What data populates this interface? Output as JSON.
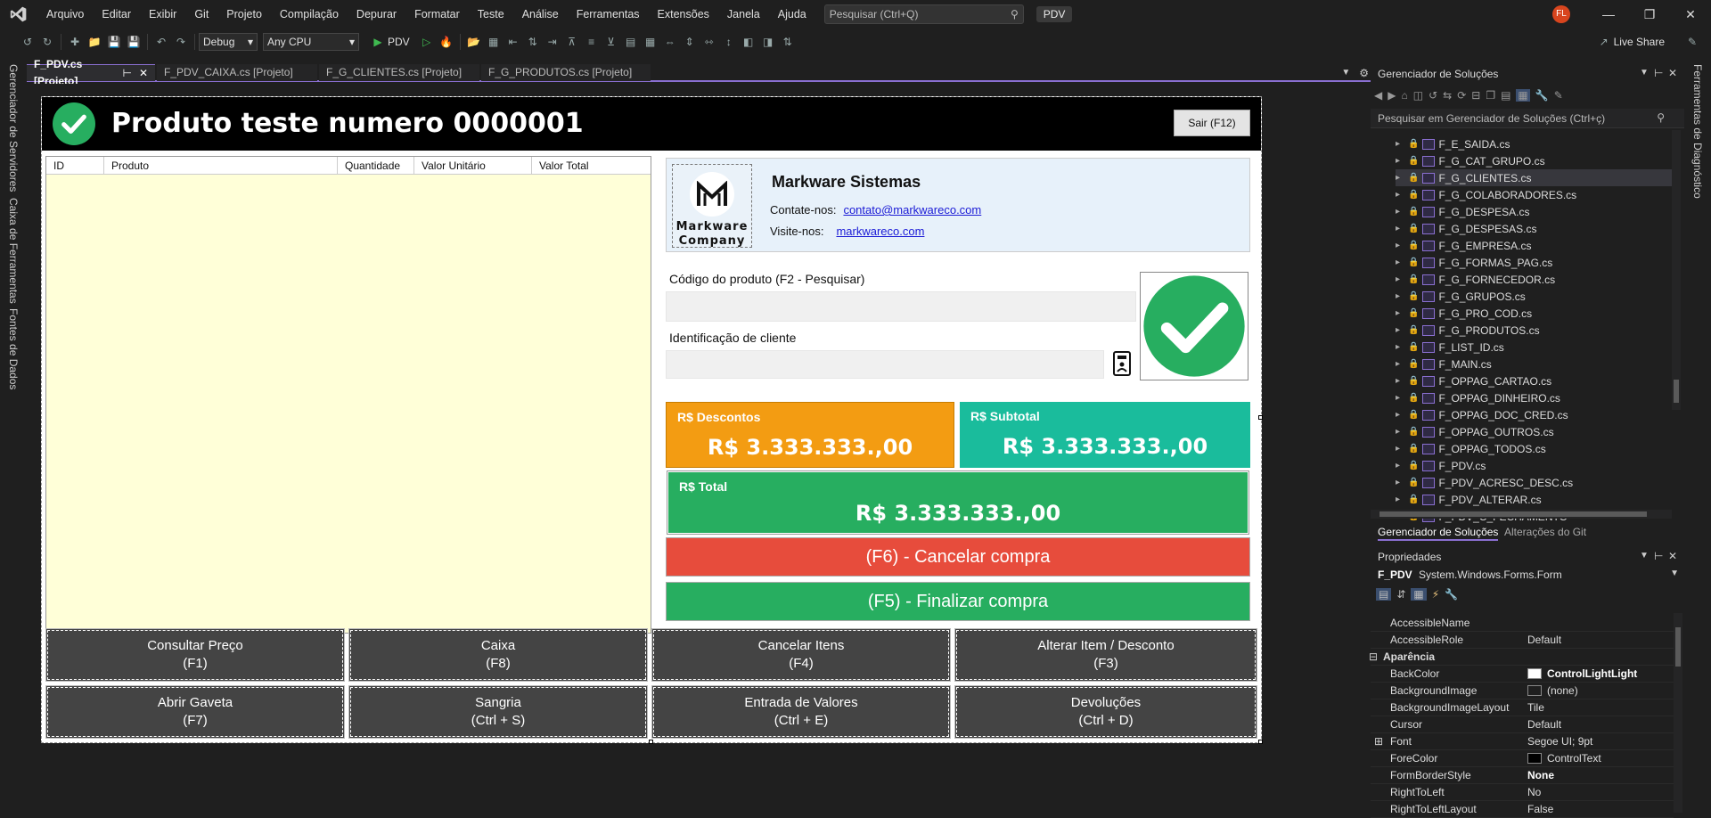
{
  "menubar": {
    "items": [
      "Arquivo",
      "Editar",
      "Exibir",
      "Git",
      "Projeto",
      "Compilação",
      "Depurar",
      "Formatar",
      "Teste",
      "Análise",
      "Ferramentas",
      "Extensões",
      "Janela",
      "Ajuda"
    ],
    "search_placeholder": "Pesquisar (Ctrl+Q)",
    "solution_badge": "PDV",
    "avatar_initials": "FL"
  },
  "toolbar": {
    "config": "Debug",
    "platform": "Any CPU",
    "run_target": "PDV",
    "live_share": "Live Share"
  },
  "left_rail": [
    "Gerenciador de Servidores",
    "Caixa de Ferramentas",
    "Fontes de Dados"
  ],
  "right_rail": [
    "Ferramentas de Diagnóstico"
  ],
  "doc_tabs": [
    {
      "label": "F_PDV.cs [Projeto]",
      "active": true
    },
    {
      "label": "F_PDV_CAIXA.cs [Projeto]"
    },
    {
      "label": "F_G_CLIENTES.cs [Projeto]"
    },
    {
      "label": "F_G_PRODUTOS.cs [Projeto]"
    }
  ],
  "form": {
    "title": "Produto teste numero 0000001",
    "exit_button": "Sair (F12)",
    "grid_columns": [
      "ID",
      "Produto",
      "Quantidade",
      "Valor Unitário",
      "Valor Total"
    ],
    "company": {
      "logo_line1": "Markware",
      "logo_line2": "Company",
      "name": "Markware Sistemas",
      "contact_label": "Contate-nos:",
      "contact_value": "contato@markwareco.com",
      "visit_label": "Visite-nos:",
      "visit_value": "markwareco.com"
    },
    "product_code_label": "Código do produto (F2 - Pesquisar)",
    "client_id_label": "Identificação de cliente",
    "discounts_label": "R$ Descontos",
    "discounts_value": "R$ 3.333.333.,00",
    "subtotal_label": "R$ Subtotal",
    "subtotal_value": "R$ 3.333.333.,00",
    "total_label": "R$ Total",
    "total_value": "R$ 3.333.333.,00",
    "cancel_purchase": "(F6) - Cancelar compra",
    "finish_purchase": "(F5) - Finalizar compra",
    "buttons": [
      {
        "label": "Consultar Preço",
        "key": "(F1)"
      },
      {
        "label": "Caixa",
        "key": "(F8)"
      },
      {
        "label": "Cancelar Itens",
        "key": "(F4)"
      },
      {
        "label": "Alterar Item / Desconto",
        "key": "(F3)"
      },
      {
        "label": "Abrir Gaveta",
        "key": "(F7)"
      },
      {
        "label": "Sangria",
        "key": "(Ctrl + S)"
      },
      {
        "label": "Entrada de Valores",
        "key": "(Ctrl + E)"
      },
      {
        "label": "Devoluções",
        "key": "(Ctrl + D)"
      }
    ],
    "colors": {
      "discount": "#f39c12",
      "subtotal": "#1abc9c",
      "total": "#27ae60",
      "cancel": "#e74c3c",
      "finish": "#27ae60"
    }
  },
  "solution_explorer": {
    "title": "Gerenciador de Soluções",
    "search_placeholder": "Pesquisar em Gerenciador de Soluções (Ctrl+ç)",
    "files": [
      "F_E_SAIDA.cs",
      "F_G_CAT_GRUPO.cs",
      "F_G_CLIENTES.cs",
      "F_G_COLABORADORES.cs",
      "F_G_DESPESA.cs",
      "F_G_DESPESAS.cs",
      "F_G_EMPRESA.cs",
      "F_G_FORMAS_PAG.cs",
      "F_G_FORNECEDOR.cs",
      "F_G_GRUPOS.cs",
      "F_G_PRO_COD.cs",
      "F_G_PRODUTOS.cs",
      "F_LIST_ID.cs",
      "F_MAIN.cs",
      "F_OPPAG_CARTAO.cs",
      "F_OPPAG_DINHEIRO.cs",
      "F_OPPAG_DOC_CRED.cs",
      "F_OPPAG_OUTROS.cs",
      "F_OPPAG_TODOS.cs",
      "F_PDV.cs",
      "F_PDV_ACRESC_DESC.cs",
      "F_PDV_ALTERAR.cs",
      "F_PDV_C_FECHAMENTO"
    ],
    "selected_index": 2,
    "tab_active": "Gerenciador de Soluções",
    "tab_other": "Alterações do Git"
  },
  "properties": {
    "title": "Propriedades",
    "object_name": "F_PDV",
    "object_type": "System.Windows.Forms.Form",
    "rows": [
      {
        "name": "AccessibleName",
        "value": ""
      },
      {
        "name": "AccessibleRole",
        "value": "Default"
      },
      {
        "name": "Aparência",
        "value": "",
        "category": true
      },
      {
        "name": "BackColor",
        "value": "ControlLightLight",
        "swatch": "#ffffff",
        "bold": true
      },
      {
        "name": "BackgroundImage",
        "value": "(none)",
        "swatch": "#1f1f1f"
      },
      {
        "name": "BackgroundImageLayout",
        "value": "Tile"
      },
      {
        "name": "Cursor",
        "value": "Default"
      },
      {
        "name": "Font",
        "value": "Segoe UI; 9pt"
      },
      {
        "name": "ForeColor",
        "value": "ControlText",
        "swatch": "#000000"
      },
      {
        "name": "FormBorderStyle",
        "value": "None",
        "bold": true
      },
      {
        "name": "RightToLeft",
        "value": "No"
      },
      {
        "name": "RightToLeftLayout",
        "value": "False"
      }
    ]
  }
}
